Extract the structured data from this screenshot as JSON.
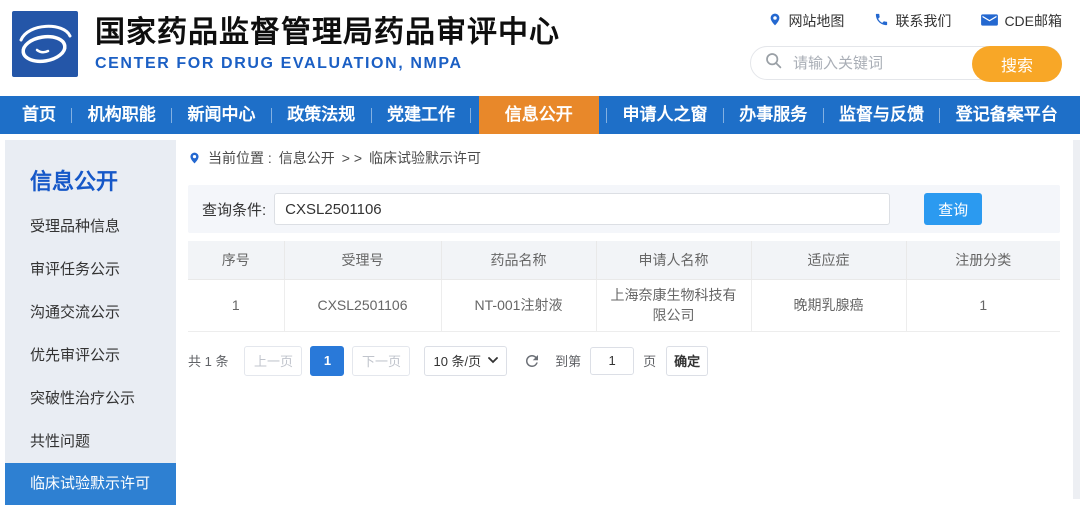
{
  "colors": {
    "nav_blue": "#1e6fc8",
    "active_orange": "#e8882a",
    "search_orange": "#f8a727",
    "sidebar_bg": "#e9edf3",
    "sidebar_title": "#1658c8",
    "sidebar_active": "#2e80d2",
    "query_blue": "#2b9af0",
    "pagination_active": "#2979d9",
    "title_en": "#1b5fc4",
    "link_blue": "#2468d0",
    "logo_bg": "#2456a8"
  },
  "header": {
    "title_cn": "国家药品监督管理局药品审评中心",
    "title_en": "CENTER FOR DRUG EVALUATION, NMPA",
    "links": [
      {
        "label": "网站地图",
        "icon": "location-pin-icon"
      },
      {
        "label": "联系我们",
        "icon": "phone-icon"
      },
      {
        "label": "CDE邮箱",
        "icon": "mail-icon"
      }
    ],
    "search": {
      "placeholder": "请输入关键词",
      "button_label": "搜索",
      "icon": "search-icon"
    }
  },
  "nav": {
    "items": [
      {
        "label": "首页",
        "active": false
      },
      {
        "label": "机构职能",
        "active": false
      },
      {
        "label": "新闻中心",
        "active": false
      },
      {
        "label": "政策法规",
        "active": false
      },
      {
        "label": "党建工作",
        "active": false
      },
      {
        "label": "信息公开",
        "active": true
      },
      {
        "label": "申请人之窗",
        "active": false
      },
      {
        "label": "办事服务",
        "active": false
      },
      {
        "label": "监督与反馈",
        "active": false
      },
      {
        "label": "登记备案平台",
        "active": false
      }
    ]
  },
  "sidebar": {
    "title": "信息公开",
    "items": [
      {
        "label": "受理品种信息",
        "active": false
      },
      {
        "label": "审评任务公示",
        "active": false
      },
      {
        "label": "沟通交流公示",
        "active": false
      },
      {
        "label": "优先审评公示",
        "active": false
      },
      {
        "label": "突破性治疗公示",
        "active": false
      },
      {
        "label": "共性问题",
        "active": false
      },
      {
        "label": "临床试验默示许可",
        "active": true
      }
    ]
  },
  "breadcrumb": {
    "icon": "location-pin-icon",
    "prefix": "当前位置 :",
    "section": "信息公开",
    "separator": "> >",
    "current": "临床试验默示许可"
  },
  "query": {
    "label": "查询条件:",
    "value": "CXSL2501106",
    "button_label": "查询"
  },
  "table": {
    "headers": [
      "序号",
      "受理号",
      "药品名称",
      "申请人名称",
      "适应症",
      "注册分类"
    ],
    "rows": [
      [
        "1",
        "CXSL2501106",
        "NT-001注射液",
        "上海奈康生物科技有限公司",
        "晚期乳腺癌",
        "1"
      ]
    ]
  },
  "pagination": {
    "total_text": "共 1 条",
    "prev_label": "上一页",
    "page": "1",
    "next_label": "下一页",
    "page_size": "10 条/页",
    "refresh_icon": "refresh-icon",
    "goto_prefix": "到第",
    "goto_value": "1",
    "goto_suffix": "页",
    "confirm_label": "确定"
  }
}
